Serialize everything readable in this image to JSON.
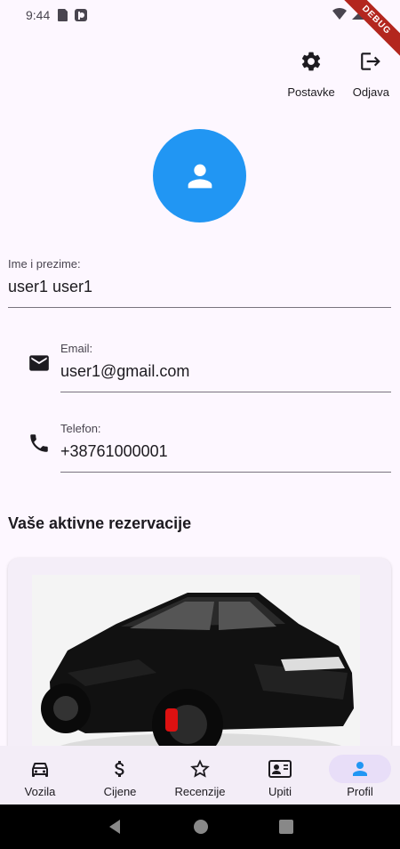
{
  "status_bar": {
    "time": "9:44",
    "debug_label": "DEBUG"
  },
  "top_actions": {
    "settings_label": "Postavke",
    "logout_label": "Odjava"
  },
  "profile": {
    "name_label": "Ime i prezime:",
    "name_value": "user1 user1",
    "email_label": "Email:",
    "email_value": "user1@gmail.com",
    "phone_label": "Telefon:",
    "phone_value": "+38761000001"
  },
  "reservations": {
    "title": "Vaše aktivne rezervacije"
  },
  "bottom_nav": {
    "items": [
      {
        "label": "Vozila",
        "icon": "car-icon"
      },
      {
        "label": "Cijene",
        "icon": "dollar-icon"
      },
      {
        "label": "Recenzije",
        "icon": "star-icon"
      },
      {
        "label": "Upiti",
        "icon": "contact-card-icon"
      },
      {
        "label": "Profil",
        "icon": "person-icon",
        "active": true
      }
    ]
  },
  "colors": {
    "accent": "#2196f3",
    "nav_active": "#e8def8",
    "background": "#fdf7ff"
  }
}
